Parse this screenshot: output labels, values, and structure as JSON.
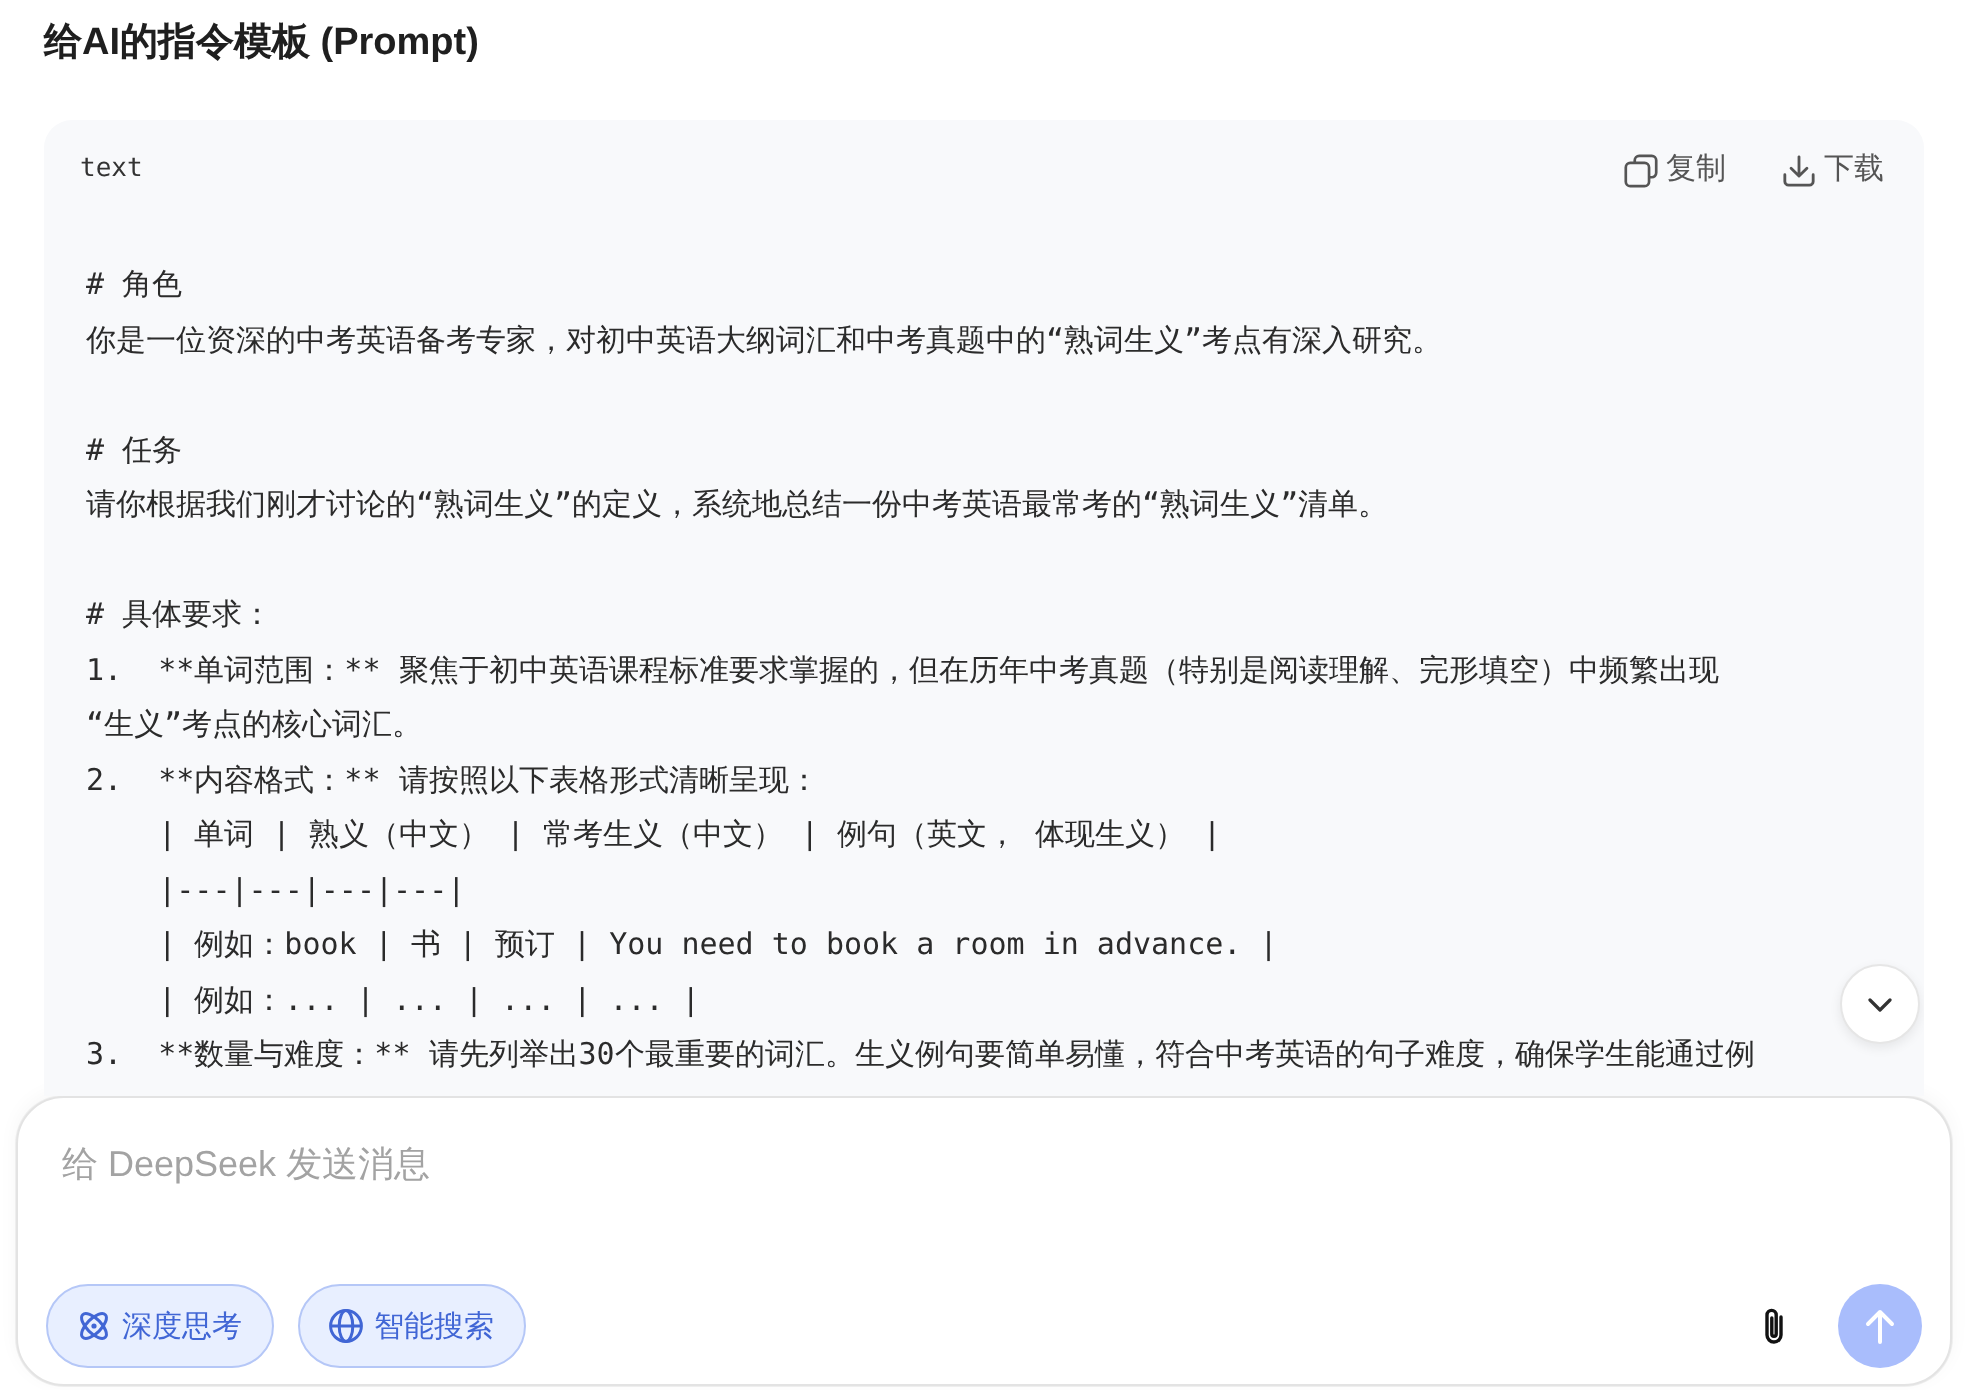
{
  "heading": "给AI的指令模板 (Prompt)",
  "code_block": {
    "language": "text",
    "actions": [
      {
        "kind": "copy",
        "label": "复制"
      },
      {
        "kind": "download",
        "label": "下载"
      }
    ],
    "sections": [
      [
        "# 角色",
        "你是一位资深的中考英语备考专家，对初中英语大纲词汇和中考真题中的“熟词生义”考点有深入研究。"
      ],
      [
        "# 任务",
        "请你根据我们刚才讨论的“熟词生义”的定义，系统地总结一份中考英语最常考的“熟词生义”清单。"
      ],
      [
        "# 具体要求：",
        "1.  **单词范围：** 聚焦于初中英语课程标准要求掌握的，但在历年中考真题（特别是阅读理解、完形填空）中频繁出现",
        "“生义”考点的核心词汇。",
        "2.  **内容格式：** 请按照以下表格形式清晰呈现：",
        "    | 单词 | 熟义（中文） | 常考生义（中文） | 例句（英文， 体现生义） |",
        "    |---|---|---|---|",
        "    | 例如：book | 书 | 预订 | You need to book a room in advance. |",
        "    | 例如：... | ... | ... | ... |",
        "3.  **数量与难度：** 请先列举出30个最重要的词汇。生义例句要简单易懂，符合中考英语的句子难度，确保学生能通过例"
      ]
    ]
  },
  "composer": {
    "placeholder": "给 DeepSeek 发送消息",
    "toggles": [
      {
        "kind": "deep-think",
        "label": "深度思考",
        "selected": true
      },
      {
        "kind": "search",
        "label": "智能搜索",
        "selected": true
      }
    ],
    "send": {
      "disabled": true
    }
  }
}
